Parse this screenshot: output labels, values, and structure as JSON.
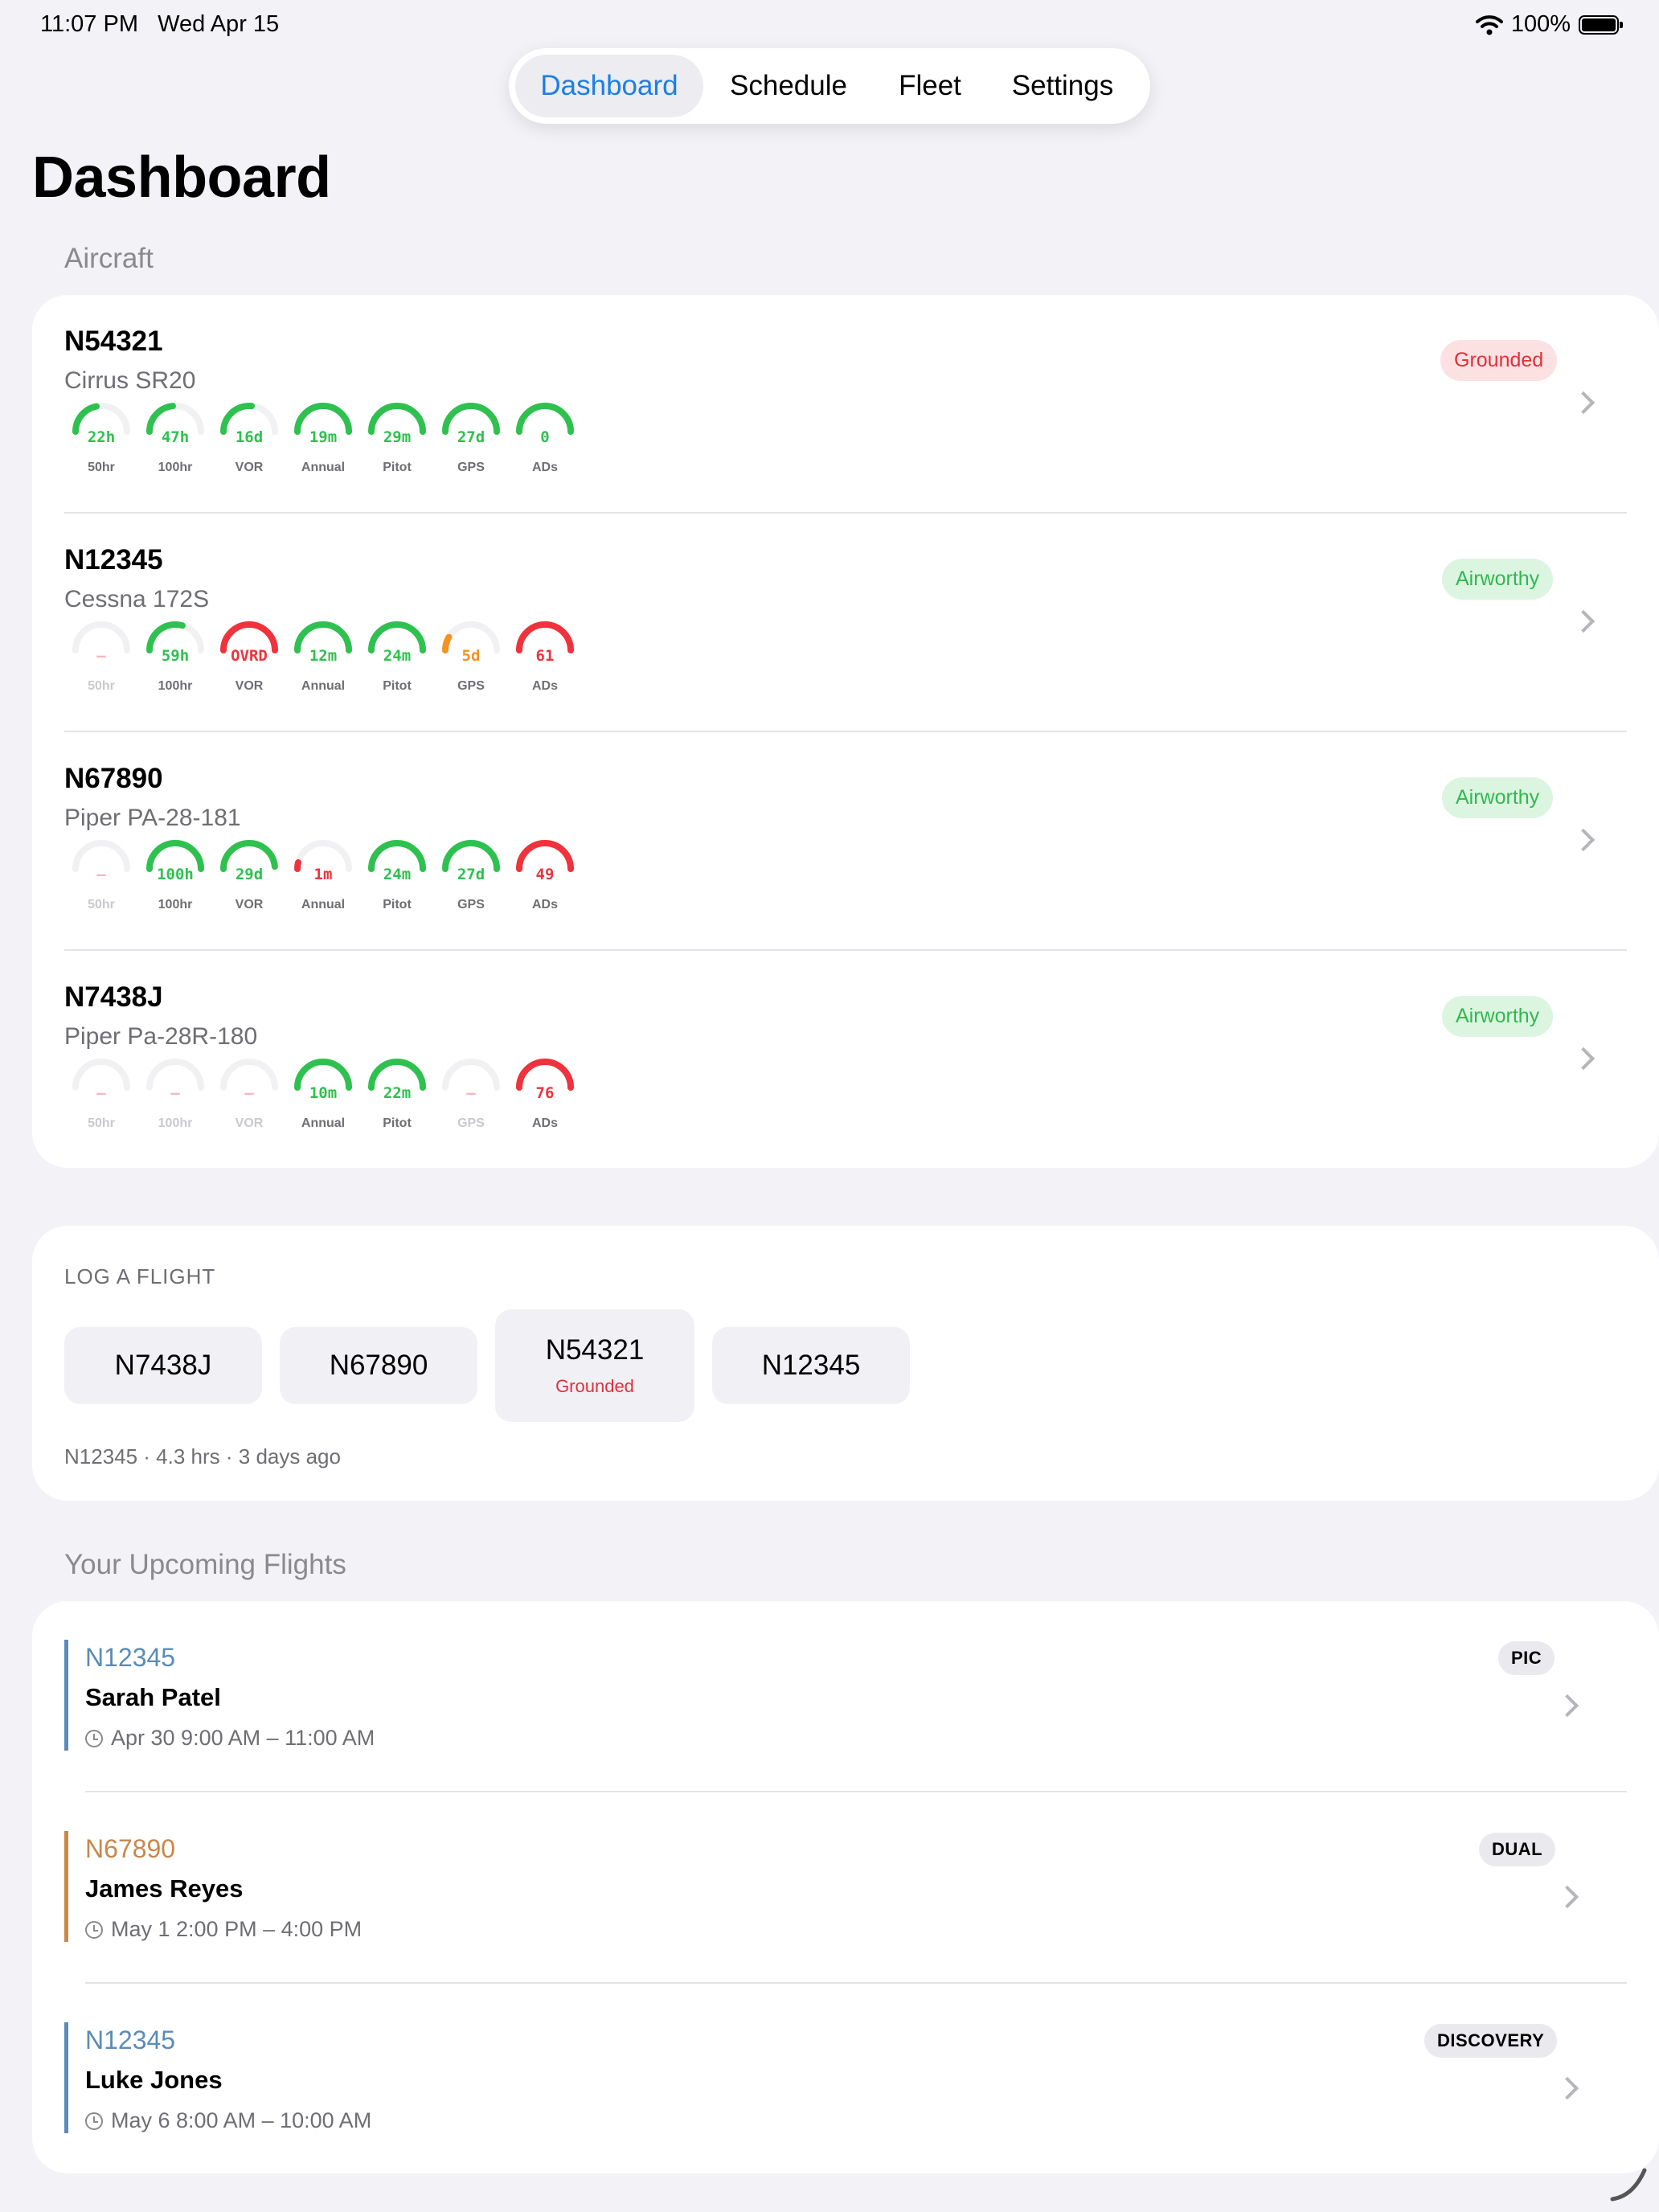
{
  "status_bar": {
    "time": "11:07 PM",
    "date": "Wed Apr 15",
    "battery": "100%"
  },
  "nav": {
    "tabs": [
      "Dashboard",
      "Schedule",
      "Fleet",
      "Settings"
    ],
    "active": 0
  },
  "page_title": "Dashboard",
  "aircraft_section": {
    "title": "Aircraft",
    "items": [
      {
        "reg": "N54321",
        "model": "Cirrus SR20",
        "status": "Grounded",
        "gauges": [
          {
            "label": "50hr",
            "value": "22h",
            "state": "green",
            "level": 0.44
          },
          {
            "label": "100hr",
            "value": "47h",
            "state": "green",
            "level": 0.47
          },
          {
            "label": "VOR",
            "value": "16d",
            "state": "green",
            "level": 0.53
          },
          {
            "label": "Annual",
            "value": "19m",
            "state": "green",
            "level": 1
          },
          {
            "label": "Pitot",
            "value": "29m",
            "state": "green",
            "level": 1
          },
          {
            "label": "GPS",
            "value": "27d",
            "state": "green",
            "level": 1
          },
          {
            "label": "ADs",
            "value": "0",
            "state": "green",
            "level": 1
          }
        ]
      },
      {
        "reg": "N12345",
        "model": "Cessna 172S",
        "status": "Airworthy",
        "gauges": [
          {
            "label": "50hr",
            "value": "–",
            "state": "none",
            "level": 0
          },
          {
            "label": "100hr",
            "value": "59h",
            "state": "green",
            "level": 0.59
          },
          {
            "label": "VOR",
            "value": "OVRD",
            "state": "red",
            "level": 1
          },
          {
            "label": "Annual",
            "value": "12m",
            "state": "green",
            "level": 1
          },
          {
            "label": "Pitot",
            "value": "24m",
            "state": "green",
            "level": 1
          },
          {
            "label": "GPS",
            "value": "5d",
            "state": "orange",
            "level": 0.17
          },
          {
            "label": "ADs",
            "value": "61",
            "state": "red",
            "level": 1
          }
        ]
      },
      {
        "reg": "N67890",
        "model": "Piper PA-28-181",
        "status": "Airworthy",
        "gauges": [
          {
            "label": "50hr",
            "value": "–",
            "state": "none",
            "level": 0
          },
          {
            "label": "100hr",
            "value": "100h",
            "state": "green",
            "level": 1
          },
          {
            "label": "VOR",
            "value": "29d",
            "state": "green",
            "level": 0.97
          },
          {
            "label": "Annual",
            "value": "1m",
            "state": "red",
            "level": 0.08
          },
          {
            "label": "Pitot",
            "value": "24m",
            "state": "green",
            "level": 1
          },
          {
            "label": "GPS",
            "value": "27d",
            "state": "green",
            "level": 1
          },
          {
            "label": "ADs",
            "value": "49",
            "state": "red",
            "level": 1
          }
        ]
      },
      {
        "reg": "N7438J",
        "model": "Piper Pa-28R-180",
        "status": "Airworthy",
        "gauges": [
          {
            "label": "50hr",
            "value": "–",
            "state": "none",
            "level": 0
          },
          {
            "label": "100hr",
            "value": "–",
            "state": "none",
            "level": 0
          },
          {
            "label": "VOR",
            "value": "–",
            "state": "none",
            "level": 0
          },
          {
            "label": "Annual",
            "value": "10m",
            "state": "green",
            "level": 1
          },
          {
            "label": "Pitot",
            "value": "22m",
            "state": "green",
            "level": 1
          },
          {
            "label": "GPS",
            "value": "–",
            "state": "none",
            "level": 0
          },
          {
            "label": "ADs",
            "value": "76",
            "state": "red",
            "level": 1
          }
        ]
      }
    ]
  },
  "log_flight": {
    "title": "LOG A FLIGHT",
    "aircraft": [
      {
        "reg": "N7438J",
        "note": ""
      },
      {
        "reg": "N67890",
        "note": ""
      },
      {
        "reg": "N54321",
        "note": "Grounded"
      },
      {
        "reg": "N12345",
        "note": ""
      }
    ],
    "last_flight": "N12345 · 4.3 hrs · 3 days ago"
  },
  "upcoming": {
    "title": "Your Upcoming Flights",
    "flights": [
      {
        "reg": "N12345",
        "name": "Sarah Patel",
        "time": "Apr 30 9:00 AM – 11:00 AM",
        "type": "PIC",
        "color": "#5b8bb8"
      },
      {
        "reg": "N67890",
        "name": "James Reyes",
        "time": "May 1 2:00 PM – 4:00 PM",
        "type": "DUAL",
        "color": "#c9874a"
      },
      {
        "reg": "N12345",
        "name": "Luke  Jones",
        "time": "May 6 8:00 AM – 10:00 AM",
        "type": "DISCOVERY",
        "color": "#5b8bb8"
      }
    ]
  },
  "colors": {
    "accent": "#1a7fe6",
    "green": "#2fc14f",
    "red": "#f0323c",
    "orange": "#f39322"
  }
}
